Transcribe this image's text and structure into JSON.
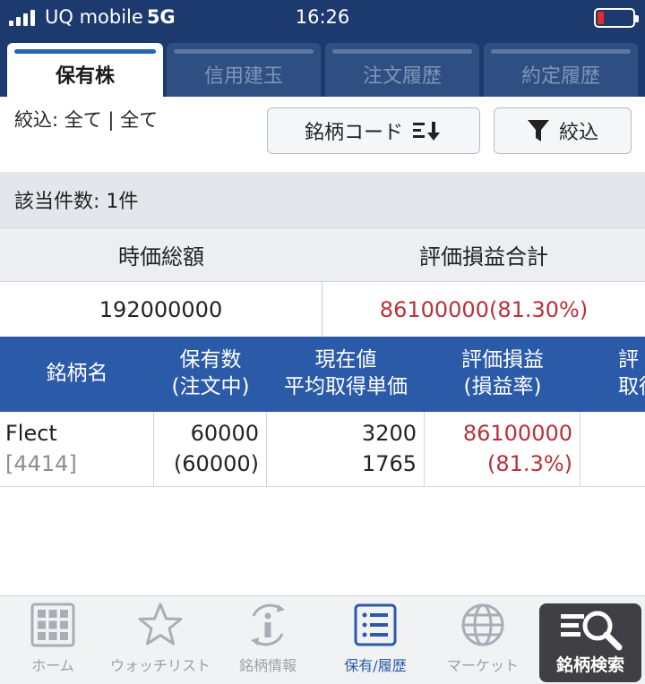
{
  "status_bar": {
    "carrier": "UQ mobile",
    "network": "5G",
    "time": "16:26"
  },
  "tabs": [
    {
      "label": "保有株",
      "active": true
    },
    {
      "label": "信用建玉",
      "active": false
    },
    {
      "label": "注文履歴",
      "active": false
    },
    {
      "label": "約定履歴",
      "active": false
    }
  ],
  "filter": {
    "label": "絞込: 全て | 全て",
    "sort_button": "銘柄コード",
    "filter_button": "絞込"
  },
  "hits": "該当件数: 1件",
  "summary": {
    "headers": [
      "時価総額",
      "評価損益合計"
    ],
    "values": [
      "192000000",
      "86100000(81.30%)"
    ]
  },
  "table": {
    "headers": [
      {
        "line1": "銘柄名",
        "line2": ""
      },
      {
        "line1": "保有数",
        "line2": "(注文中)"
      },
      {
        "line1": "現在値",
        "line2": "平均取得単価"
      },
      {
        "line1": "評価損益",
        "line2": "(損益率)"
      },
      {
        "line1": "評",
        "line2": "取得"
      }
    ],
    "rows": [
      {
        "name": "Flect",
        "code": "[4414]",
        "qty": "60000",
        "qty_ordering": "(60000)",
        "price": "3200",
        "avg_cost": "1765",
        "pl": "86100000",
        "pl_rate": "(81.3%)"
      }
    ]
  },
  "bottom_nav": [
    {
      "label": "ホーム",
      "icon": "home-grid-icon"
    },
    {
      "label": "ウォッチリスト",
      "icon": "star-icon"
    },
    {
      "label": "銘柄情報",
      "icon": "info-icon"
    },
    {
      "label": "保有/履歴",
      "icon": "list-icon",
      "active": true
    },
    {
      "label": "マーケット",
      "icon": "globe-icon"
    }
  ],
  "search_button": {
    "label": "銘柄検索",
    "icon": "search-icon"
  },
  "colors": {
    "navy": "#1d3a6e",
    "header_blue": "#2b5aa8",
    "loss_red": "#b8313a"
  }
}
